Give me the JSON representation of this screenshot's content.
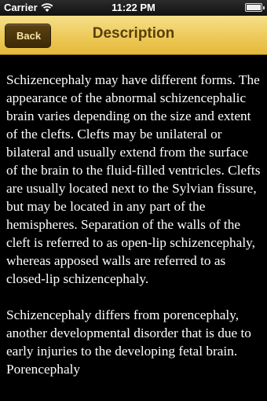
{
  "status_bar": {
    "carrier": "Carrier",
    "time": "11:22 PM"
  },
  "nav": {
    "back_label": "Back",
    "title": "Description"
  },
  "content": {
    "paragraphs": [
      "Schizencephaly may have different forms. The appearance of the abnormal schizencephalic brain varies depending on the size and extent of the clefts. Clefts may be unilateral or bilateral and usually extend from the surface of the brain to the fluid-filled ventricles. Clefts are usually located next to the Sylvian fissure, but may be located in any part of the hemispheres. Separation of the walls of the cleft is referred to as open-lip schizencephaly, whereas apposed walls are referred to as closed-lip schizencephaly.",
      "Schizencephaly differs from porencephaly, another developmental disorder that is due to early injuries to the developing fetal brain. Porencephaly"
    ]
  },
  "colors": {
    "nav_gold": "#efcd61",
    "back_button": "#4a330b",
    "title_text": "#5a3f0c",
    "background": "#000000"
  }
}
